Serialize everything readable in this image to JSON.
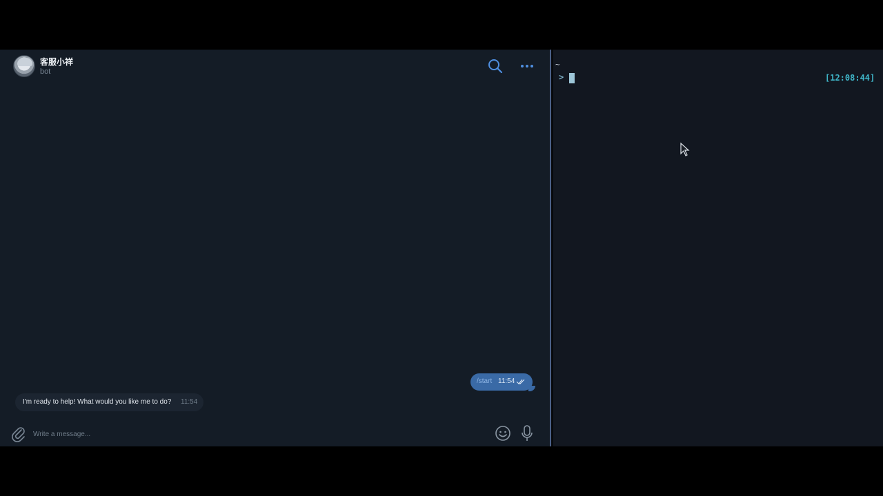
{
  "chat": {
    "title": "客服小祥",
    "subtitle": "bot",
    "messages_out": [
      {
        "text": "/start",
        "time": "11:54"
      }
    ],
    "messages_in": [
      {
        "text": "I'm ready to help! What would you like me to do?",
        "time": "11:54"
      }
    ],
    "composer": {
      "placeholder": "Write a message..."
    },
    "icons": {
      "header_right": [
        "search-icon",
        "more-icon"
      ],
      "composer_left": "paperclip-icon",
      "composer_right": [
        "emoji-icon",
        "microphone-icon"
      ]
    }
  },
  "terminal": {
    "cwd": "~",
    "prompt_symbol": ">",
    "clock": "[12:08:44]"
  },
  "colors": {
    "chat_bg": "#141c26",
    "outgoing_bubble": "#3a6aa6",
    "incoming_bubble": "#1c2531",
    "accent": "#4f8fe0",
    "terminal_bg": "#121720",
    "terminal_clock": "#3fb6c9"
  }
}
